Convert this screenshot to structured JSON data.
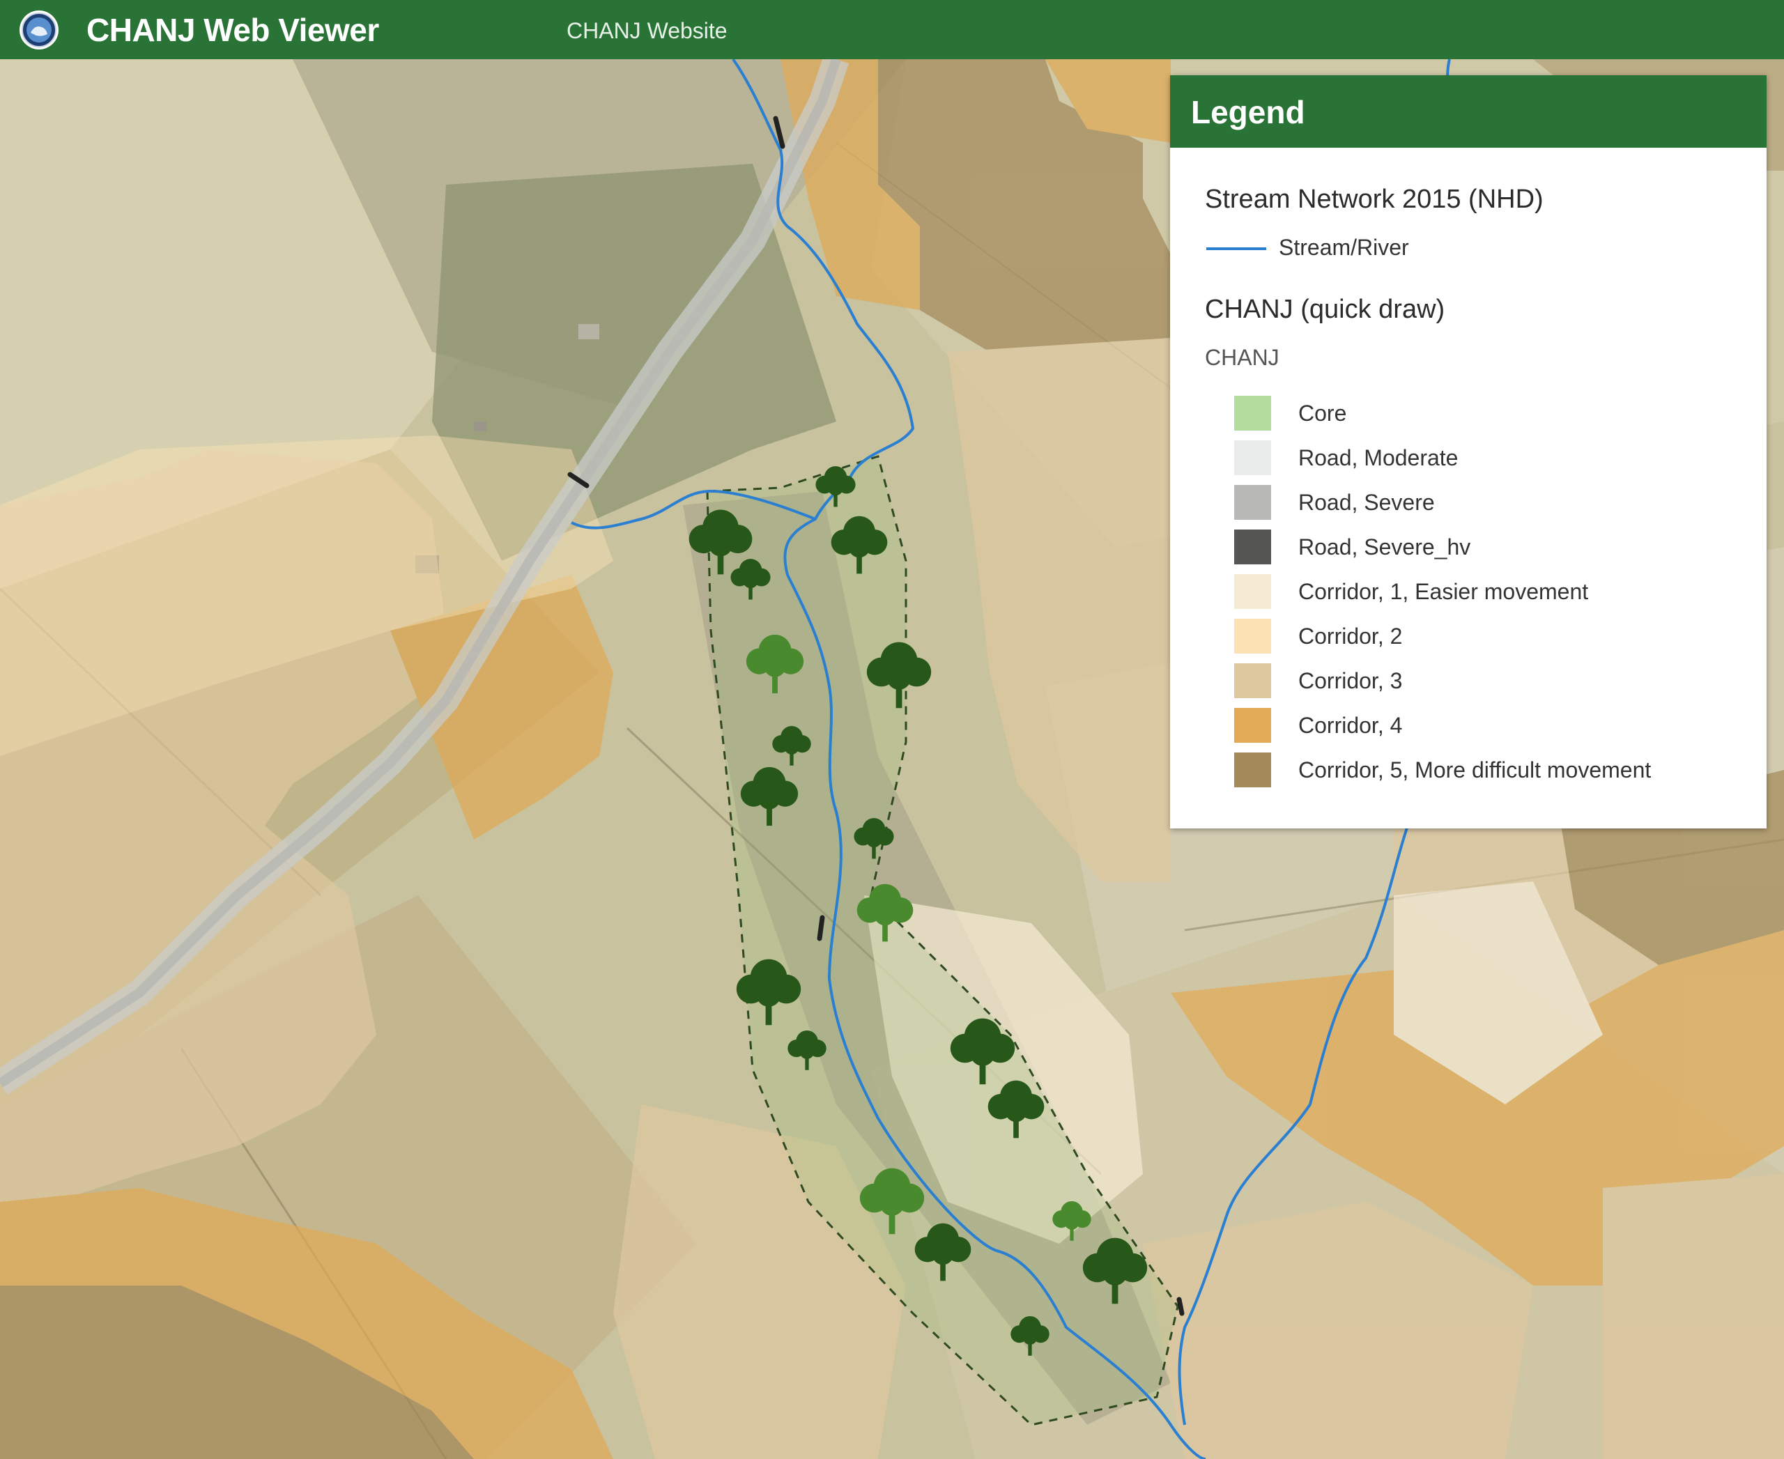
{
  "header": {
    "app_title": "CHANJ Web Viewer",
    "website_link": "CHANJ Website",
    "background_color": "#287335"
  },
  "legend": {
    "title": "Legend",
    "stream_layer": {
      "title": "Stream Network 2015 (NHD)",
      "item_label": "Stream/River",
      "color": "#2b7fd1"
    },
    "chanj_layer": {
      "title": "CHANJ (quick draw)",
      "subtitle": "CHANJ",
      "items": [
        {
          "label": "Core",
          "color": "#b3dc9e"
        },
        {
          "label": "Road, Moderate",
          "color": "#e8ecea"
        },
        {
          "label": "Road, Severe",
          "color": "#b8b9b4"
        },
        {
          "label": "Road, Severe_hv",
          "color": "#565753"
        },
        {
          "label": "Corridor, 1, Easier movement",
          "color": "#f5ead2"
        },
        {
          "label": "Corridor, 2",
          "color": "#fbe2b4"
        },
        {
          "label": "Corridor, 3",
          "color": "#dec8a0"
        },
        {
          "label": "Corridor, 4",
          "color": "#e0aa56"
        },
        {
          "label": "Corridor, 5, More difficult movement",
          "color": "#a38a5a"
        }
      ]
    }
  },
  "map": {
    "layers": [
      "aerial-imagery",
      "chanj-corridor-raster",
      "stream-network",
      "road-crossings",
      "restoration-area",
      "tree-symbols"
    ],
    "tree_colors": {
      "dark": "#275719",
      "light": "#4a8a2e"
    }
  }
}
